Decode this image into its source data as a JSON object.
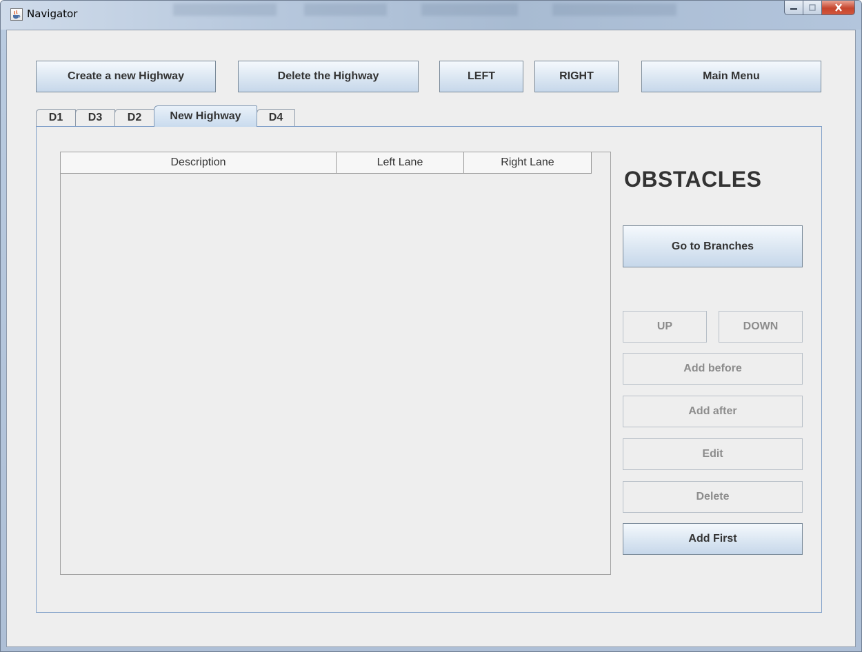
{
  "window": {
    "title": "Navigator"
  },
  "toolbar": {
    "create_label": "Create a new Highway",
    "delete_label": "Delete the Highway",
    "left_label": "LEFT",
    "right_label": "RIGHT",
    "main_menu_label": "Main Menu"
  },
  "tabs": [
    {
      "label": "D1",
      "selected": false
    },
    {
      "label": "D3",
      "selected": false
    },
    {
      "label": "D2",
      "selected": false
    },
    {
      "label": "New Highway",
      "selected": true
    },
    {
      "label": "D4",
      "selected": false
    }
  ],
  "table": {
    "columns": [
      "Description",
      "Left Lane",
      "Right Lane"
    ],
    "rows": []
  },
  "side_panel": {
    "heading": "OBSTACLES",
    "go_to_branches_label": "Go to Branches",
    "up_label": "UP",
    "down_label": "DOWN",
    "add_before_label": "Add before",
    "add_after_label": "Add after",
    "edit_label": "Edit",
    "delete_label": "Delete",
    "add_first_label": "Add First",
    "disabled_buttons": [
      "UP",
      "DOWN",
      "Add before",
      "Add after",
      "Edit",
      "Delete"
    ]
  },
  "colors": {
    "window_bg": "#eeeeee",
    "button_gradient_top": "#f5f9fd",
    "button_gradient_bottom": "#c6d7ea",
    "button_border": "#7a8a99",
    "disabled_text": "#8c8c8c",
    "tab_panel_border": "#7f9fc8",
    "close_button": "#c5452d"
  },
  "icons": {
    "app": "java-cup-icon",
    "minimize": "minimize-icon",
    "maximize": "maximize-icon",
    "close": "close-icon"
  }
}
